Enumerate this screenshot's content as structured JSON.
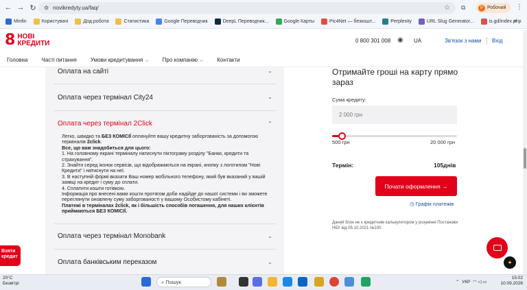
{
  "browser": {
    "url": "novikredyty.ua/faq/",
    "profile_label": "Робочий",
    "profile_initial": "Р",
    "bookmarks": [
      "Minfin",
      "Користувачі",
      "Дод.робота",
      "Статистика",
      "Google Переводчик",
      "DeepL Переводчик...",
      "Google Карты",
      "Pic4Net — безкошт...",
      "Perplexity",
      "URL Slug Generator...",
      "is.gd/index.php"
    ],
    "more": "»"
  },
  "header": {
    "logo_line1": "НОВІ",
    "logo_line2": "КРЕДИТИ",
    "phone": "0 800 301 008",
    "lang": "UA",
    "contact": "Зв'язок з нами",
    "login": "Вхід"
  },
  "nav": [
    {
      "label": "Головна"
    },
    {
      "label": "Часті питання"
    },
    {
      "label": "Умови кредитування",
      "chev": "⌵"
    },
    {
      "label": "Про компанію",
      "chev": "⌵"
    },
    {
      "label": "Контакти"
    }
  ],
  "faq": {
    "items": [
      {
        "label": "Оплата на сайті",
        "chev": "⌄"
      },
      {
        "label": "Оплата через термінал City24",
        "chev": "⌄"
      },
      {
        "label": "Оплата через термінал 2Click",
        "chev": "⌃"
      },
      {
        "label": "Оплата через термінал Monobank",
        "chev": "⌄"
      },
      {
        "label": "Оплата банківським переказом",
        "chev": "⌄"
      }
    ],
    "body": {
      "intro1": "Легко, швидко та ",
      "intro_bold": "БЕЗ КОМІСІЇ",
      "intro2": " оплачуйте вашу кредитну заборгованість за допомогою терміналів ",
      "intro_bold2": "2click",
      "intro3": ".",
      "needs": "Все, що вам знадобиться для цього:",
      "steps": [
        "1. На головному екрані терміналу натиснути піктограму розділу \"Банки, кредити та страхування\".",
        "2. Знайти серед іконок сервісів, що відображаються на екрані, кнопку з логотипом \"Нові Кредити\" і натиснути на неї.",
        "3. В наступній формі вказати Ваш номер мобільного телефону, який був вказаний у вашій заявці на кредит і суму до сплати.",
        "4. Сплатити кошти готівкою."
      ],
      "info": "Інформація про внесені вами кошти протягом доби надійде до нашої системи і ви зможете переглянути оновлену суму заборгованості у вашому Особистому кабінеті.",
      "note": "Платежі в терміналах 2click, як і більшість способів погашення, для наших клієнтів приймаються БЕЗ КОМІСІЇ."
    }
  },
  "calculator": {
    "title": "Отримайте гроші на карту прямо зараз",
    "amount_label": "Сума кредиту:",
    "amount_placeholder": "2 000 грн",
    "min": "500 грн",
    "max": "20 000 грн",
    "slider_min": 500,
    "slider_max": 20000,
    "slider_value": 2000,
    "term_label": "Термін:",
    "term_value": "105днів",
    "apply": "Почати оформлення →",
    "schedule": "Графік платежів",
    "disclaimer": "Даний блок не є кредитним калькулятором у розумінні Постанови НБУ від 05.10.2021 №100."
  },
  "float": {
    "get_credit_line1": "Взяти",
    "get_credit_line2": "кредит"
  },
  "taskbar": {
    "temp": "20°C",
    "weather": "Безвітрі",
    "search": "Пошук",
    "lang": "УКР",
    "time": "15:02",
    "date": "10.09.2026"
  },
  "colors": {
    "brand": "#e2001a",
    "link": "#1a4fa0"
  }
}
